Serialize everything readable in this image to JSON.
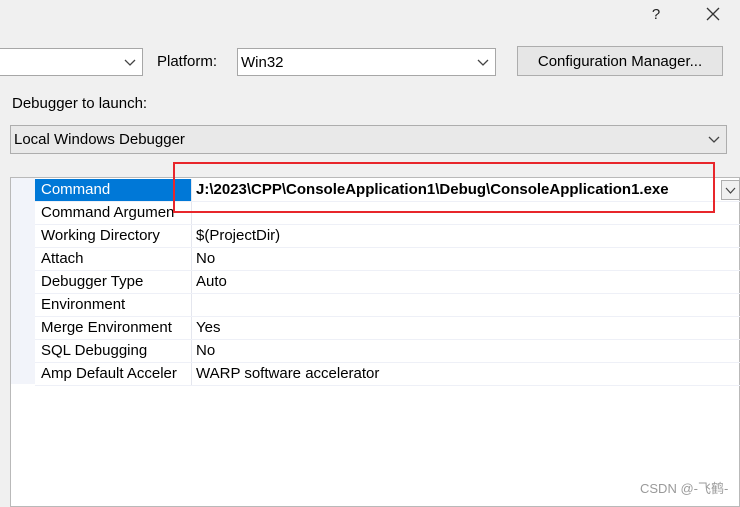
{
  "titlebar": {
    "help_label": "?"
  },
  "platform": {
    "label": "Platform:",
    "value": "Win32"
  },
  "config_manager_label": "Configuration Manager...",
  "debugger": {
    "label": "Debugger to launch:",
    "value": "Local Windows Debugger"
  },
  "properties": [
    {
      "name": "Command",
      "value": "J:\\2023\\CPP\\ConsoleApplication1\\Debug\\ConsoleApplication1.exe"
    },
    {
      "name": "Command Argumen",
      "value": ""
    },
    {
      "name": "Working Directory",
      "value": "$(ProjectDir)"
    },
    {
      "name": "Attach",
      "value": "No"
    },
    {
      "name": "Debugger Type",
      "value": "Auto"
    },
    {
      "name": "Environment",
      "value": ""
    },
    {
      "name": "Merge Environment",
      "value": "Yes"
    },
    {
      "name": "SQL Debugging",
      "value": "No"
    },
    {
      "name": "Amp Default Acceler",
      "value": "WARP software accelerator"
    }
  ],
  "watermark": "CSDN @-飞鹤-",
  "colors": {
    "selection": "#0078d7",
    "highlight_box": "#e8262b"
  }
}
